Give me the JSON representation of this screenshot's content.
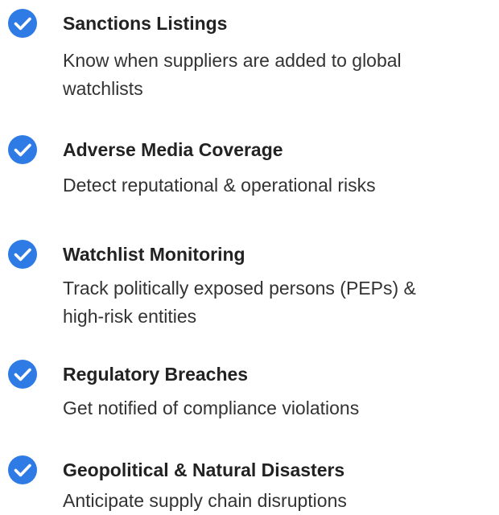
{
  "accent_color": "#2f7be5",
  "icon": "check-circle-icon",
  "features": [
    {
      "title": "Sanctions Listings",
      "description": "Know when suppliers are added to global watchlists"
    },
    {
      "title": "Adverse Media Coverage",
      "description": "Detect reputational & operational risks"
    },
    {
      "title": "Watchlist Monitoring",
      "description": "Track politically exposed persons (PEPs) & high-risk entities"
    },
    {
      "title": "Regulatory Breaches",
      "description": "Get notified of compliance violations"
    },
    {
      "title": "Geopolitical & Natural Disasters",
      "description": "Anticipate supply chain disruptions"
    }
  ]
}
